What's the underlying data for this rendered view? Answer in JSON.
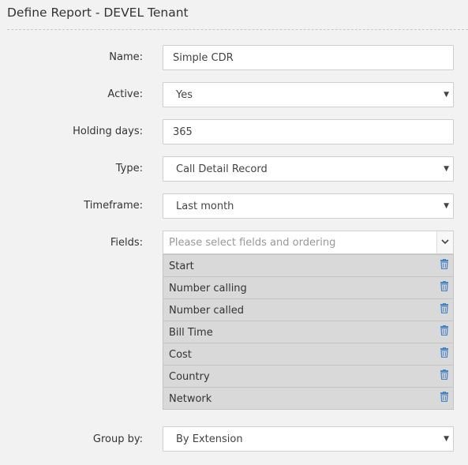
{
  "title": "Define Report - DEVEL Tenant",
  "form": {
    "name": {
      "label": "Name:",
      "value": "Simple CDR"
    },
    "active": {
      "label": "Active:",
      "value": "Yes"
    },
    "holding_days": {
      "label": "Holding days:",
      "value": "365"
    },
    "type": {
      "label": "Type:",
      "value": "Call Detail Record"
    },
    "timeframe": {
      "label": "Timeframe:",
      "value": "Last month"
    },
    "fields": {
      "label": "Fields:",
      "placeholder": "Please select fields and ordering",
      "items": [
        "Start",
        "Number calling",
        "Number called",
        "Bill Time",
        "Cost",
        "Country",
        "Network"
      ]
    },
    "group_by": {
      "label": "Group by:",
      "value": "By Extension"
    }
  },
  "colors": {
    "background": "#f2f2f2",
    "delete_icon": "#4a86c5",
    "selected_item": "#d9d9d9"
  },
  "icons": {
    "dropdown": "triangle-down",
    "delete": "trash-icon",
    "expand": "chevron-down-icon"
  }
}
